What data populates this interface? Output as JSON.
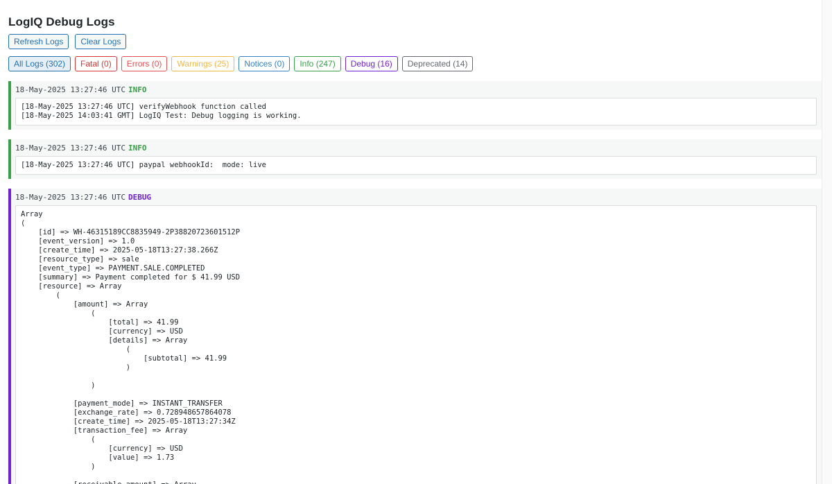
{
  "page": {
    "title": "LogIQ Debug Logs"
  },
  "actions": {
    "refresh_label": "Refresh Logs",
    "clear_label": "Clear Logs"
  },
  "filters": [
    {
      "label": "All Logs (302)",
      "color": "#2271b1",
      "active": true
    },
    {
      "label": "Fatal (0)",
      "color": "#d63638",
      "active": false
    },
    {
      "label": "Errors (0)",
      "color": "#e65054",
      "active": false
    },
    {
      "label": "Warnings (25)",
      "color": "#f0b849",
      "active": false
    },
    {
      "label": "Notices (0)",
      "color": "#3582c4",
      "active": false
    },
    {
      "label": "Info (247)",
      "color": "#3aa04a",
      "active": false
    },
    {
      "label": "Debug (16)",
      "color": "#7022d2",
      "active": false
    },
    {
      "label": "Deprecated (14)",
      "color": "#646970",
      "active": false
    }
  ],
  "level_colors": {
    "INFO": "#3aa04a",
    "DEBUG": "#7022d2"
  },
  "entries": [
    {
      "timestamp": "18-May-2025 13:27:46 UTC",
      "level": "INFO",
      "message": "[18-May-2025 13:27:46 UTC] verifyWebhook function called\n[18-May-2025 14:03:41 GMT] LogIQ Test: Debug logging is working."
    },
    {
      "timestamp": "18-May-2025 13:27:46 UTC",
      "level": "INFO",
      "message": "[18-May-2025 13:27:46 UTC] paypal webhookId:  mode: live"
    },
    {
      "timestamp": "18-May-2025 13:27:46 UTC",
      "level": "DEBUG",
      "message": "Array\n(\n    [id] => WH-46315189CC8835949-2P38820723601512P\n    [event_version] => 1.0\n    [create_time] => 2025-05-18T13:27:38.266Z\n    [resource_type] => sale\n    [event_type] => PAYMENT.SALE.COMPLETED\n    [summary] => Payment completed for $ 41.99 USD\n    [resource] => Array\n        (\n            [amount] => Array\n                (\n                    [total] => 41.99\n                    [currency] => USD\n                    [details] => Array\n                        (\n                            [subtotal] => 41.99\n                        )\n\n                )\n\n            [payment_mode] => INSTANT_TRANSFER\n            [exchange_rate] => 0.728948657864078\n            [create_time] => 2025-05-18T13:27:34Z\n            [transaction_fee] => Array\n                (\n                    [currency] => USD\n                    [value] => 1.73\n                )\n\n            [receivable_amount] => Array"
    }
  ]
}
